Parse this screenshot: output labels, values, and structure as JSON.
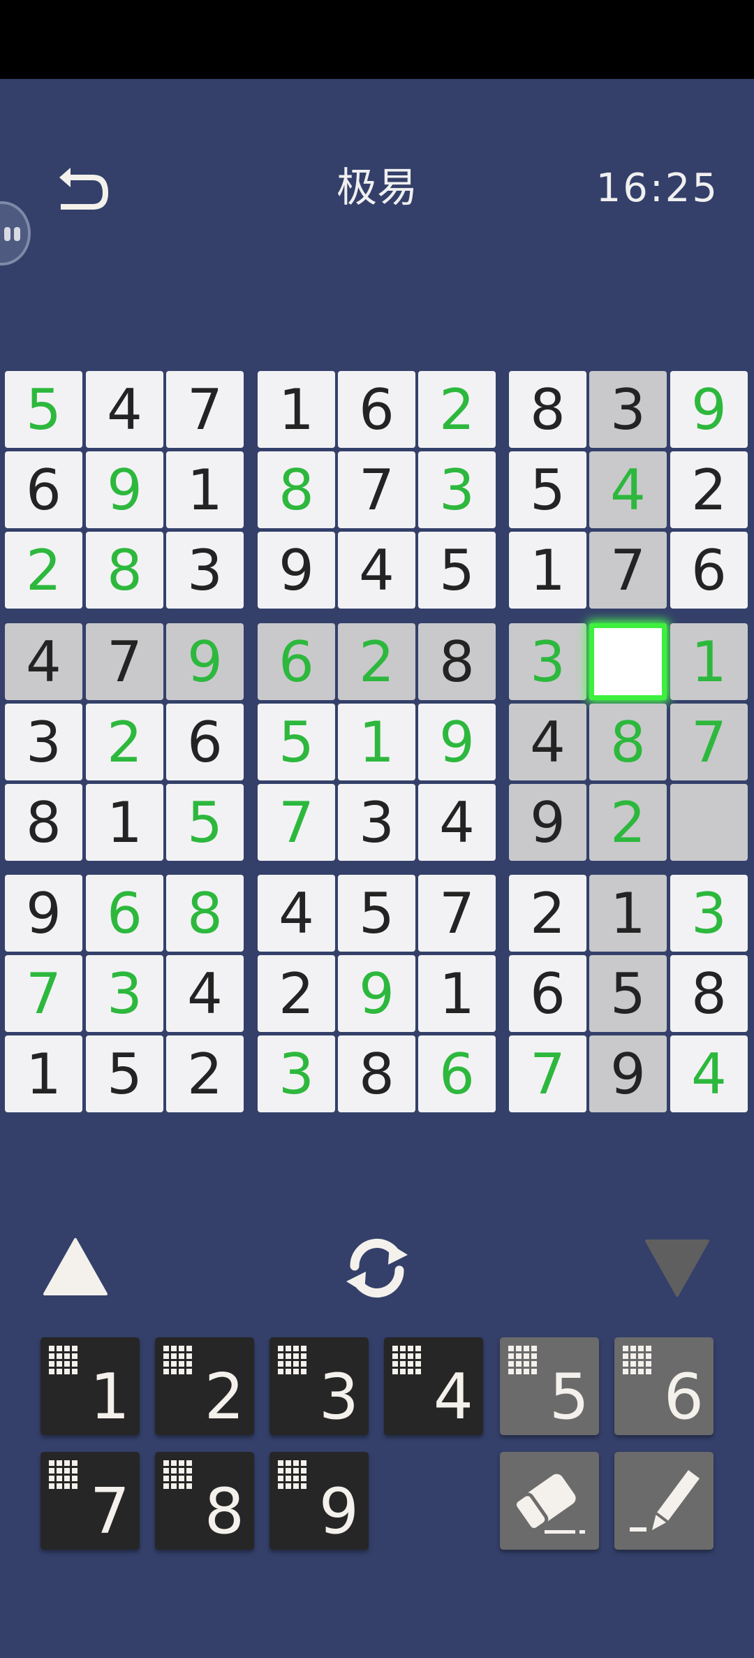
{
  "header": {
    "title": "极易",
    "timer": "16:25"
  },
  "board": {
    "rows": [
      [
        "5",
        "4",
        "7",
        "1",
        "6",
        "2",
        "8",
        "3",
        "9"
      ],
      [
        "6",
        "9",
        "1",
        "8",
        "7",
        "3",
        "5",
        "4",
        "2"
      ],
      [
        "2",
        "8",
        "3",
        "9",
        "4",
        "5",
        "1",
        "7",
        "6"
      ],
      [
        "4",
        "7",
        "9",
        "6",
        "2",
        "8",
        "3",
        "",
        "1"
      ],
      [
        "3",
        "2",
        "6",
        "5",
        "1",
        "9",
        "4",
        "8",
        "7"
      ],
      [
        "8",
        "1",
        "5",
        "7",
        "3",
        "4",
        "9",
        "2",
        ""
      ],
      [
        "9",
        "6",
        "8",
        "4",
        "5",
        "7",
        "2",
        "1",
        "3"
      ],
      [
        "7",
        "3",
        "4",
        "2",
        "9",
        "1",
        "6",
        "5",
        "8"
      ],
      [
        "1",
        "5",
        "2",
        "3",
        "8",
        "6",
        "7",
        "9",
        "4"
      ]
    ],
    "user_entered": [
      "G.....G..G",
      "",
      ""
    ],
    "green_mask": [
      [
        1,
        0,
        0,
        0,
        0,
        1,
        0,
        0,
        1
      ],
      [
        0,
        1,
        0,
        1,
        0,
        1,
        0,
        1,
        0
      ],
      [
        1,
        1,
        0,
        0,
        0,
        0,
        0,
        0,
        0
      ],
      [
        0,
        0,
        1,
        1,
        1,
        0,
        1,
        0,
        1
      ],
      [
        0,
        1,
        0,
        1,
        1,
        1,
        0,
        1,
        1
      ],
      [
        0,
        0,
        1,
        1,
        0,
        0,
        0,
        1,
        0
      ],
      [
        0,
        1,
        1,
        0,
        0,
        0,
        0,
        0,
        1
      ],
      [
        1,
        1,
        0,
        0,
        1,
        0,
        0,
        0,
        0
      ],
      [
        0,
        0,
        0,
        1,
        0,
        1,
        1,
        0,
        1
      ]
    ],
    "selected": {
      "row": 3,
      "col": 7
    },
    "colors": {
      "given": "#232323",
      "entered": "#2db83d",
      "highlight": "#c9c9cb",
      "cell": "#f2f2f4",
      "selected_glow": "#3ef03e"
    }
  },
  "controls": {
    "up_icon": "triangle-up-icon",
    "refresh_icon": "refresh-icon",
    "down_icon": "triangle-down-icon"
  },
  "numpad": {
    "numbers": [
      "1",
      "2",
      "3",
      "4",
      "5",
      "6",
      "7",
      "8",
      "9"
    ],
    "completed": [
      "5",
      "6"
    ],
    "eraser_icon": "eraser-icon",
    "pencil_icon": "pencil-icon"
  },
  "theme": {
    "background": "#34406a",
    "button_dark": "#262626",
    "button_dim": "#6b6b6b"
  }
}
